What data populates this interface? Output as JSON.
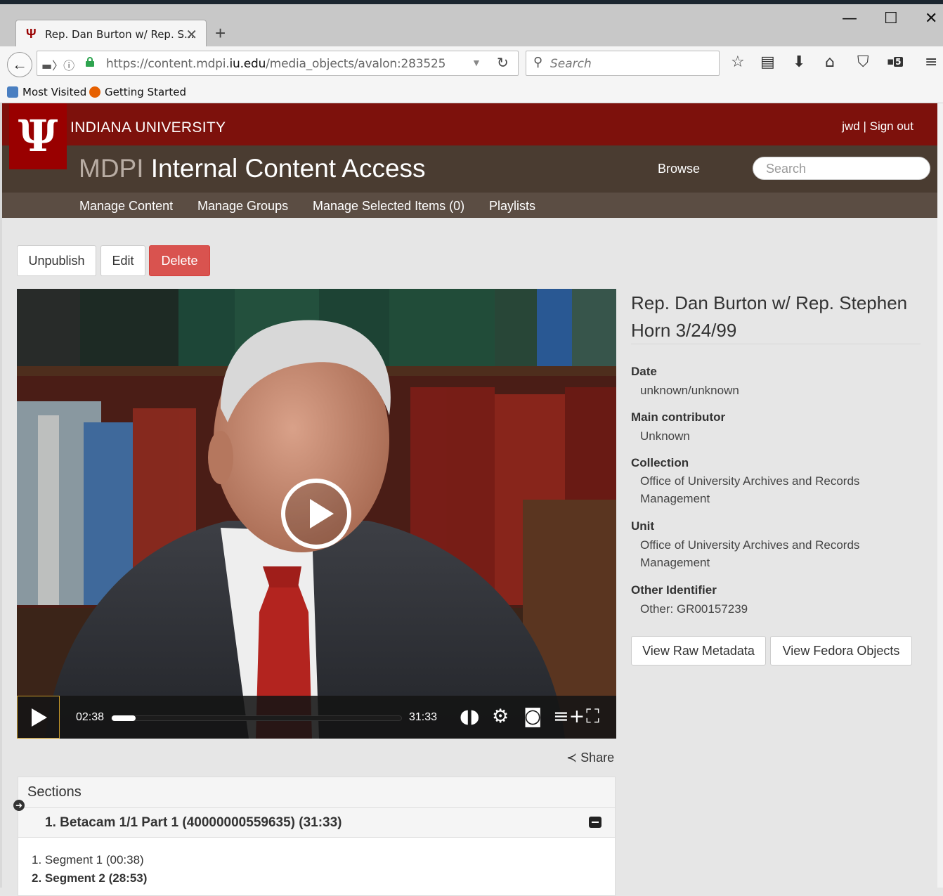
{
  "browser": {
    "tab_title": "Rep. Dan Burton w/ Rep. S...",
    "url_prefix": "https://content.mdpi.",
    "url_domain": "iu.edu",
    "url_path": "/media_objects/avalon:283525",
    "search_placeholder": "Search",
    "bookmarks": [
      "Most Visited",
      "Getting Started"
    ],
    "badge_count": "5"
  },
  "header": {
    "university": "INDIANA UNIVERSITY",
    "user": "jwd | Sign out",
    "site_prefix": "MDPI",
    "site_title": "Internal Content Access",
    "browse": "Browse",
    "search_placeholder": "Search"
  },
  "menu": [
    "Manage Content",
    "Manage Groups",
    "Manage Selected Items (0)",
    "Playlists"
  ],
  "actions": {
    "unpublish": "Unpublish",
    "edit": "Edit",
    "delete": "Delete"
  },
  "player": {
    "current_time": "02:38",
    "duration": "31:33",
    "progress": 0.083
  },
  "share": "Share",
  "sections": {
    "heading": "Sections",
    "part": "1. Betacam 1/1 Part 1 (40000000559635) (31:33)",
    "segments": [
      {
        "label": "1. Segment 1 (00:38)",
        "active": false
      },
      {
        "label": "2. Segment 2 (28:53)",
        "active": true
      }
    ]
  },
  "metadata": {
    "title": "Rep. Dan Burton w/ Rep. Stephen Horn 3/24/99",
    "fields": [
      {
        "label": "Date",
        "value": "unknown/unknown"
      },
      {
        "label": "Main contributor",
        "value": "Unknown"
      },
      {
        "label": "Collection",
        "value": "Office of University Archives and Records Management"
      },
      {
        "label": "Unit",
        "value": "Office of University Archives and Records Management"
      },
      {
        "label": "Other Identifier",
        "value": "Other: GR00157239"
      }
    ],
    "view_raw": "View Raw Metadata",
    "view_fedora": "View Fedora Objects"
  },
  "colors": {
    "iu_crimson": "#990000",
    "header_red": "#7d110c",
    "site_brown": "#4a3c31",
    "danger": "#d9534f"
  }
}
